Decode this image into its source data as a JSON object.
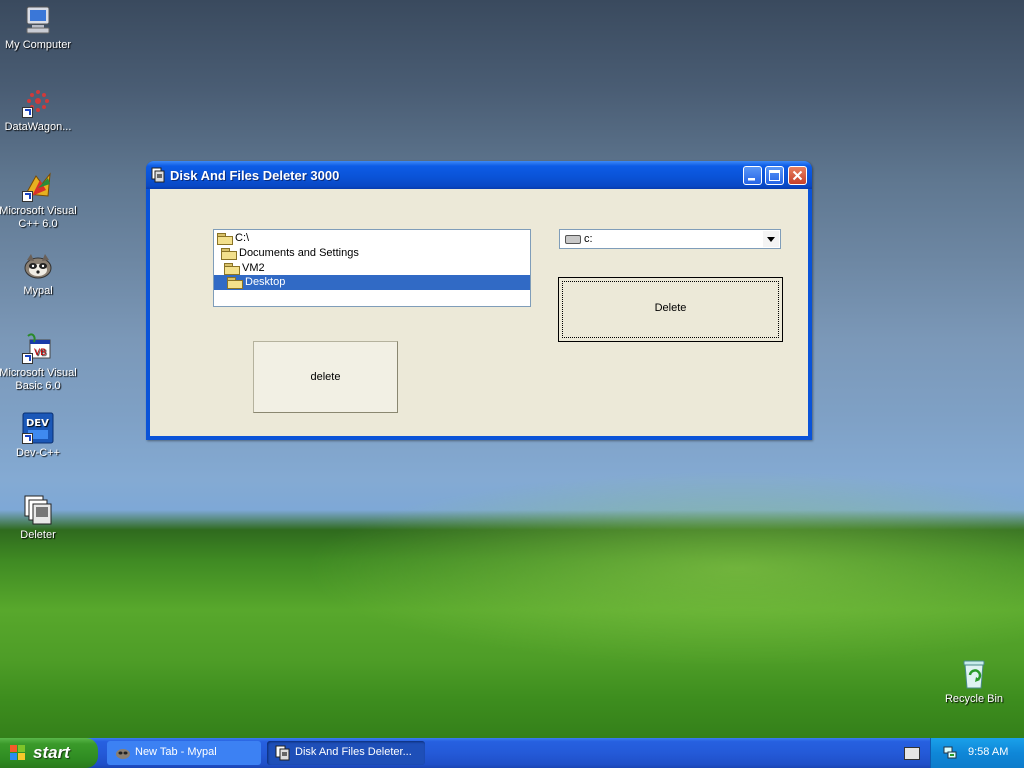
{
  "desktop": {
    "icons": [
      {
        "label": "My Computer"
      },
      {
        "label": "DataWagon..."
      },
      {
        "label": "Microsoft Visual C++ 6.0"
      },
      {
        "label": "Mypal"
      },
      {
        "label": "Microsoft Visual Basic 6.0"
      },
      {
        "label": "Dev-C++"
      },
      {
        "label": "Deleter"
      },
      {
        "label": "Recycle Bin"
      }
    ]
  },
  "window": {
    "title": "Disk And Files Deleter 3000",
    "tree": {
      "items": [
        {
          "label": "C:\\"
        },
        {
          "label": "Documents and Settings"
        },
        {
          "label": "VM2"
        },
        {
          "label": "Desktop"
        }
      ],
      "selected": "Desktop"
    },
    "drive_combo": {
      "value": "c:"
    },
    "delete_button_big": {
      "label": "Delete"
    },
    "delete_button_small": {
      "label": "delete"
    }
  },
  "taskbar": {
    "start_label": "start",
    "tasks": [
      {
        "label": "New Tab - Mypal"
      },
      {
        "label": "Disk And Files Deleter..."
      }
    ],
    "clock": "9:58 AM"
  },
  "colors": {
    "title_blue": "#0a52d6",
    "selection": "#316ac5",
    "start_green": "#3a9a2a"
  }
}
